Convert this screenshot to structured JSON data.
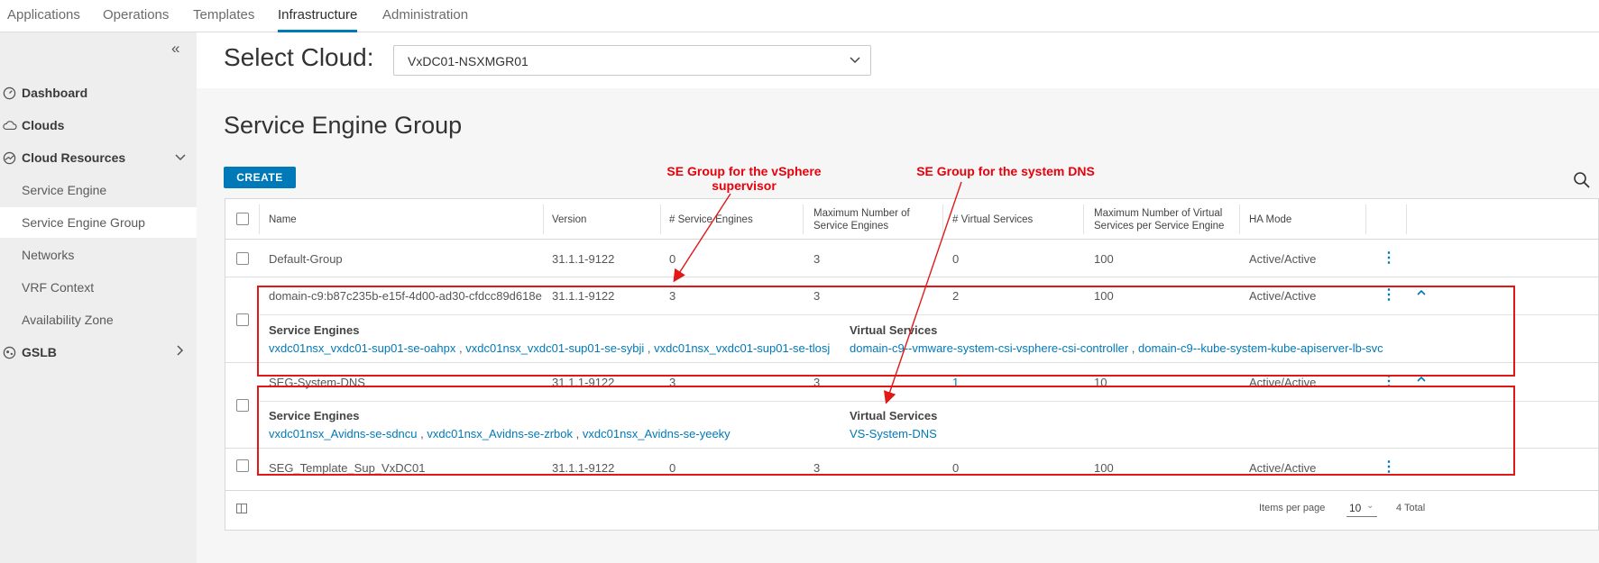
{
  "topnav": {
    "tabs": [
      {
        "label": "Applications"
      },
      {
        "label": "Operations"
      },
      {
        "label": "Templates"
      },
      {
        "label": "Infrastructure"
      },
      {
        "label": "Administration"
      }
    ],
    "active": "Infrastructure"
  },
  "sidebar": {
    "items": [
      {
        "label": "Dashboard",
        "icon": "dashboard-icon"
      },
      {
        "label": "Clouds",
        "icon": "cloud-icon"
      },
      {
        "label": "Cloud Resources",
        "icon": "cloud-resources-icon"
      },
      {
        "label": "Service Engine"
      },
      {
        "label": "Service Engine Group"
      },
      {
        "label": "Networks"
      },
      {
        "label": "VRF Context"
      },
      {
        "label": "Availability Zone"
      },
      {
        "label": "GSLB",
        "icon": "gslb-icon"
      }
    ],
    "active": "Service Engine Group"
  },
  "cloud": {
    "label": "Select Cloud:",
    "selected": "VxDC01-NSXMGR01"
  },
  "page": {
    "title": "Service Engine Group",
    "create_label": "CREATE"
  },
  "table": {
    "headers": {
      "name": "Name",
      "version": "Version",
      "se_count": "# Service Engines",
      "max_se": "Maximum Number of Service Engines",
      "vs_count": "# Virtual Services",
      "max_vs": "Maximum Number of Virtual Services per Service Engine",
      "ha": "HA Mode"
    },
    "rows": [
      {
        "name": "Default-Group",
        "version": "31.1.1-9122",
        "se": "0",
        "max_se": "3",
        "vs": "0",
        "max_vs": "100",
        "ha": "Active/Active"
      },
      {
        "name": "domain-c9:b87c235b-e15f-4d00-ad30-cfdcc89d618e",
        "version": "31.1.1-9122",
        "se": "3",
        "max_se": "3",
        "vs": "2",
        "max_vs": "100",
        "ha": "Active/Active",
        "detail": {
          "se_heading": "Service Engines",
          "service_engines": [
            "vxdc01nsx_vxdc01-sup01-se-oahpx",
            "vxdc01nsx_vxdc01-sup01-se-sybji",
            "vxdc01nsx_vxdc01-sup01-se-tlosj"
          ],
          "vs_heading": "Virtual Services",
          "virtual_services": [
            "domain-c9--vmware-system-csi-vsphere-csi-controller",
            "domain-c9--kube-system-kube-apiserver-lb-svc"
          ]
        }
      },
      {
        "name": "SEG-System-DNS",
        "version": "31.1.1-9122",
        "se": "3",
        "max_se": "3",
        "vs": "1",
        "max_vs": "10",
        "ha": "Active/Active",
        "detail": {
          "se_heading": "Service Engines",
          "service_engines": [
            "vxdc01nsx_Avidns-se-sdncu",
            "vxdc01nsx_Avidns-se-zrbok",
            "vxdc01nsx_Avidns-se-yeeky"
          ],
          "vs_heading": "Virtual Services",
          "virtual_services": [
            "VS-System-DNS"
          ]
        }
      },
      {
        "name": "SEG_Template_Sup_VxDC01",
        "version": "31.1.1-9122",
        "se": "0",
        "max_se": "3",
        "vs": "0",
        "max_vs": "100",
        "ha": "Active/Active"
      }
    ],
    "separator": ",",
    "footer": {
      "items_per_page_label": "Items per page",
      "items_per_page": "10",
      "total": "4 Total"
    }
  },
  "annotations": [
    {
      "text": "SE Group for the vSphere supervisor"
    },
    {
      "text": "SE Group for the system DNS"
    }
  ],
  "colors": {
    "accent": "#0079b8",
    "annotation": "#e8000b",
    "sidebar_bg": "#eeeeee"
  }
}
